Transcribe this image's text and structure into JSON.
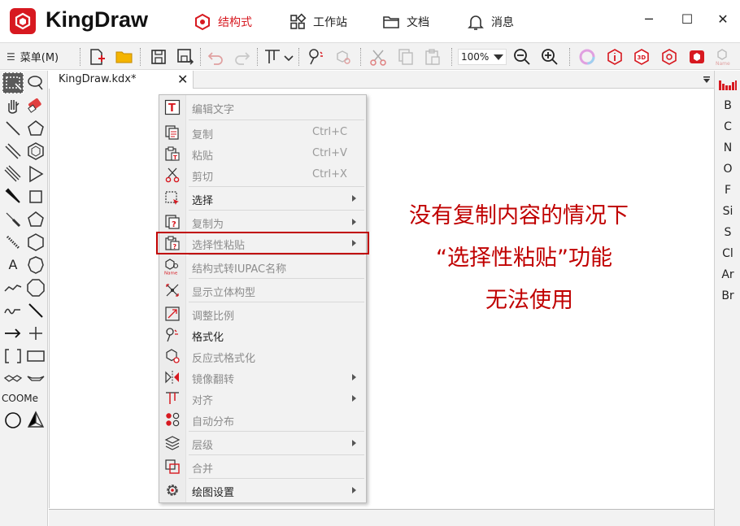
{
  "app": {
    "name": "KingDraw"
  },
  "nav": {
    "structure": "结构式",
    "workspace": "工作站",
    "documents": "文档",
    "messages": "消息"
  },
  "window": {
    "minimize": "─",
    "maximize": "☐",
    "close": "✕"
  },
  "toolbar": {
    "menu_label": "菜单(M)",
    "zoom": "100%"
  },
  "tab": {
    "filename": "KingDraw.kdx*",
    "close": "✕"
  },
  "left_tools": {
    "text_tool": "A",
    "cooh": "COOMe"
  },
  "elements": [
    "B",
    "C",
    "N",
    "O",
    "F",
    "Si",
    "S",
    "Cl",
    "Ar",
    "Br"
  ],
  "context_menu": {
    "edit_text": "编辑文字",
    "copy": "复制",
    "copy_shortcut": "Ctrl+C",
    "paste": "粘贴",
    "paste_shortcut": "Ctrl+V",
    "cut": "剪切",
    "cut_shortcut": "Ctrl+X",
    "select": "选择",
    "copy_as": "复制为",
    "paste_special": "选择性粘贴",
    "to_iupac": "结构式转IUPAC名称",
    "show_3d": "显示立体构型",
    "scale": "调整比例",
    "format": "格式化",
    "reaction_format": "反应式格式化",
    "mirror_flip": "镜像翻转",
    "align": "对齐",
    "auto_distribute": "自动分布",
    "layer": "层级",
    "merge": "合并",
    "drawing_settings": "绘图设置"
  },
  "annotation": {
    "line1": "没有复制内容的情况下",
    "line2": "“选择性粘贴”功能",
    "line3": "无法使用"
  },
  "colors": {
    "brand_red": "#d71920",
    "annotation_red": "#c00000"
  }
}
